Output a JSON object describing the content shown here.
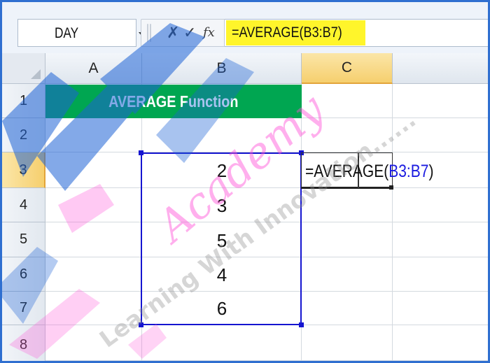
{
  "formula_bar": {
    "name_box": "DAY",
    "cancel_icon": "✗",
    "enter_icon": "✓",
    "function_icon": "fx",
    "formula": "=AVERAGE(B3:B7)"
  },
  "columns": [
    "A",
    "B",
    "C"
  ],
  "rows": [
    "1",
    "2",
    "3",
    "4",
    "5",
    "6",
    "7",
    "8"
  ],
  "cells": {
    "title": "AVERAGE Function",
    "values": [
      "2",
      "3",
      "5",
      "4",
      "6"
    ],
    "c3_prefix": "=AVERAGE(",
    "c3_ref": "B3:B7",
    "c3_suffix": ")"
  },
  "watermark": {
    "academy": "Academy",
    "tagline": "Learning With Innovation......"
  },
  "colors": {
    "title_fill": "#00a651",
    "formula_highlight": "#fff52b",
    "selection": "#1515d0",
    "active_header": "#f6cf6e",
    "watermark_blue": "#1e63d6",
    "watermark_pink": "#ff4fd8"
  }
}
